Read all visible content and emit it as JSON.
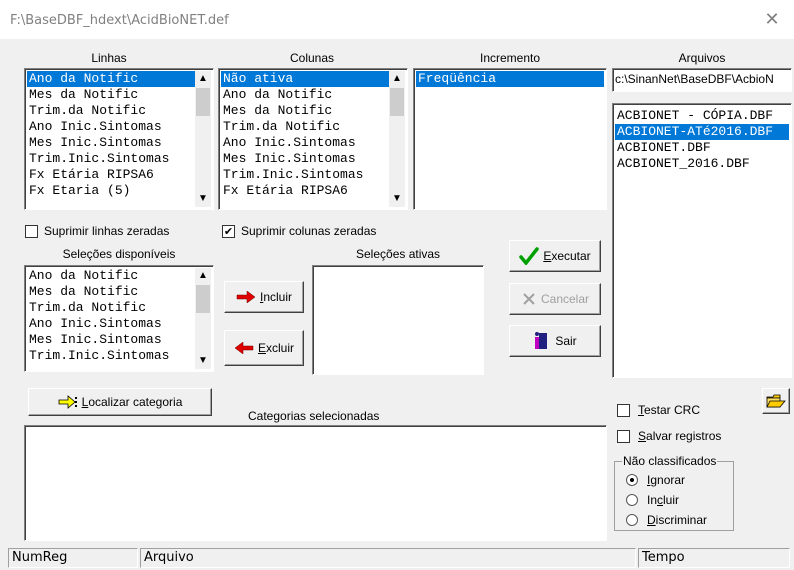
{
  "window": {
    "title": "F:\\BaseDBF_hdext\\AcidBioNET.def",
    "close_glyph": "✕"
  },
  "labels": {
    "linhas": "Linhas",
    "colunas": "Colunas",
    "incremento": "Incremento",
    "arquivos": "Arquivos",
    "selecoes_disponiveis": "Seleções disponíveis",
    "selecoes_ativas": "Seleções ativas",
    "categorias_selecionadas": "Categorias selecionadas",
    "nao_classificados": "Não classificados"
  },
  "linhas": {
    "items": [
      "Ano da Notific",
      "Mes da Notific",
      "Trim.da Notific",
      "Ano Inic.Sintomas",
      "Mes Inic.Sintomas",
      "Trim.Inic.Sintomas",
      "Fx Etária RIPSA6",
      "Fx Etaria (5)"
    ],
    "selected_index": 0
  },
  "colunas": {
    "items": [
      "Não ativa",
      "Ano da Notific",
      "Mes da Notific",
      "Trim.da Notific",
      "Ano Inic.Sintomas",
      "Mes Inic.Sintomas",
      "Trim.Inic.Sintomas",
      "Fx Etária RIPSA6"
    ],
    "selected_index": 0
  },
  "incremento": {
    "items": [
      "Freqüência"
    ],
    "selected_index": 0
  },
  "arquivos": {
    "path": "c:\\SinanNet\\BaseDBF\\AcbioN",
    "items": [
      "ACBIONET - CÓPIA.DBF",
      "ACBIONET-ATé2016.DBF",
      "ACBIONET.DBF",
      "ACBIONET_2016.DBF"
    ],
    "selected_index": 1
  },
  "checkboxes": {
    "suprimir_linhas": {
      "label": "Suprimir linhas zeradas",
      "checked": false
    },
    "suprimir_colunas": {
      "label": "Suprimir colunas zeradas",
      "checked": true
    },
    "testar_crc": {
      "label": "Testar CRC",
      "checked": false
    },
    "salvar_registros": {
      "label": "Salvar registros",
      "checked": false
    }
  },
  "selecoes_disponiveis": {
    "items": [
      "Ano da Notific",
      "Mes da Notific",
      "Trim.da Notific",
      "Ano Inic.Sintomas",
      "Mes Inic.Sintomas",
      "Trim.Inic.Sintomas"
    ]
  },
  "buttons": {
    "incluir": "Incluir",
    "excluir": "Excluir",
    "executar": "Executar",
    "cancelar": "Cancelar",
    "sair": "Sair",
    "localizar": "Localizar categoria"
  },
  "radios": {
    "ignorar": {
      "label": "Ignorar",
      "checked": true
    },
    "incluir": {
      "label": "Incluir",
      "checked": false
    },
    "discriminar": {
      "label": "Discriminar",
      "checked": false
    }
  },
  "status": {
    "numreg": "NumReg",
    "arquivo": "Arquivo",
    "tempo": "Tempo"
  },
  "colors": {
    "selection": "#0078d7",
    "arrow_red": "#e00000",
    "check_green": "#00a000"
  }
}
